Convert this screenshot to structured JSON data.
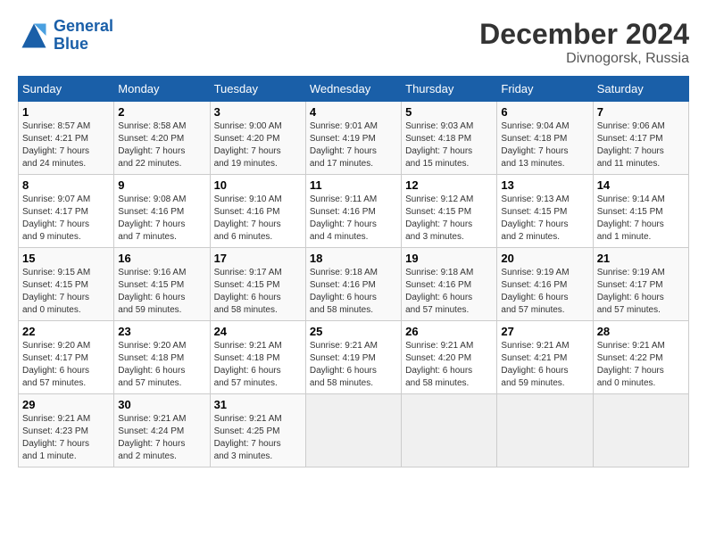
{
  "header": {
    "logo_line1": "General",
    "logo_line2": "Blue",
    "title": "December 2024",
    "subtitle": "Divnogorsk, Russia"
  },
  "weekdays": [
    "Sunday",
    "Monday",
    "Tuesday",
    "Wednesday",
    "Thursday",
    "Friday",
    "Saturday"
  ],
  "weeks": [
    [
      {
        "day": "1",
        "info": "Sunrise: 8:57 AM\nSunset: 4:21 PM\nDaylight: 7 hours\nand 24 minutes."
      },
      {
        "day": "2",
        "info": "Sunrise: 8:58 AM\nSunset: 4:20 PM\nDaylight: 7 hours\nand 22 minutes."
      },
      {
        "day": "3",
        "info": "Sunrise: 9:00 AM\nSunset: 4:20 PM\nDaylight: 7 hours\nand 19 minutes."
      },
      {
        "day": "4",
        "info": "Sunrise: 9:01 AM\nSunset: 4:19 PM\nDaylight: 7 hours\nand 17 minutes."
      },
      {
        "day": "5",
        "info": "Sunrise: 9:03 AM\nSunset: 4:18 PM\nDaylight: 7 hours\nand 15 minutes."
      },
      {
        "day": "6",
        "info": "Sunrise: 9:04 AM\nSunset: 4:18 PM\nDaylight: 7 hours\nand 13 minutes."
      },
      {
        "day": "7",
        "info": "Sunrise: 9:06 AM\nSunset: 4:17 PM\nDaylight: 7 hours\nand 11 minutes."
      }
    ],
    [
      {
        "day": "8",
        "info": "Sunrise: 9:07 AM\nSunset: 4:17 PM\nDaylight: 7 hours\nand 9 minutes."
      },
      {
        "day": "9",
        "info": "Sunrise: 9:08 AM\nSunset: 4:16 PM\nDaylight: 7 hours\nand 7 minutes."
      },
      {
        "day": "10",
        "info": "Sunrise: 9:10 AM\nSunset: 4:16 PM\nDaylight: 7 hours\nand 6 minutes."
      },
      {
        "day": "11",
        "info": "Sunrise: 9:11 AM\nSunset: 4:16 PM\nDaylight: 7 hours\nand 4 minutes."
      },
      {
        "day": "12",
        "info": "Sunrise: 9:12 AM\nSunset: 4:15 PM\nDaylight: 7 hours\nand 3 minutes."
      },
      {
        "day": "13",
        "info": "Sunrise: 9:13 AM\nSunset: 4:15 PM\nDaylight: 7 hours\nand 2 minutes."
      },
      {
        "day": "14",
        "info": "Sunrise: 9:14 AM\nSunset: 4:15 PM\nDaylight: 7 hours\nand 1 minute."
      }
    ],
    [
      {
        "day": "15",
        "info": "Sunrise: 9:15 AM\nSunset: 4:15 PM\nDaylight: 7 hours\nand 0 minutes."
      },
      {
        "day": "16",
        "info": "Sunrise: 9:16 AM\nSunset: 4:15 PM\nDaylight: 6 hours\nand 59 minutes."
      },
      {
        "day": "17",
        "info": "Sunrise: 9:17 AM\nSunset: 4:15 PM\nDaylight: 6 hours\nand 58 minutes."
      },
      {
        "day": "18",
        "info": "Sunrise: 9:18 AM\nSunset: 4:16 PM\nDaylight: 6 hours\nand 58 minutes."
      },
      {
        "day": "19",
        "info": "Sunrise: 9:18 AM\nSunset: 4:16 PM\nDaylight: 6 hours\nand 57 minutes."
      },
      {
        "day": "20",
        "info": "Sunrise: 9:19 AM\nSunset: 4:16 PM\nDaylight: 6 hours\nand 57 minutes."
      },
      {
        "day": "21",
        "info": "Sunrise: 9:19 AM\nSunset: 4:17 PM\nDaylight: 6 hours\nand 57 minutes."
      }
    ],
    [
      {
        "day": "22",
        "info": "Sunrise: 9:20 AM\nSunset: 4:17 PM\nDaylight: 6 hours\nand 57 minutes."
      },
      {
        "day": "23",
        "info": "Sunrise: 9:20 AM\nSunset: 4:18 PM\nDaylight: 6 hours\nand 57 minutes."
      },
      {
        "day": "24",
        "info": "Sunrise: 9:21 AM\nSunset: 4:18 PM\nDaylight: 6 hours\nand 57 minutes."
      },
      {
        "day": "25",
        "info": "Sunrise: 9:21 AM\nSunset: 4:19 PM\nDaylight: 6 hours\nand 58 minutes."
      },
      {
        "day": "26",
        "info": "Sunrise: 9:21 AM\nSunset: 4:20 PM\nDaylight: 6 hours\nand 58 minutes."
      },
      {
        "day": "27",
        "info": "Sunrise: 9:21 AM\nSunset: 4:21 PM\nDaylight: 6 hours\nand 59 minutes."
      },
      {
        "day": "28",
        "info": "Sunrise: 9:21 AM\nSunset: 4:22 PM\nDaylight: 7 hours\nand 0 minutes."
      }
    ],
    [
      {
        "day": "29",
        "info": "Sunrise: 9:21 AM\nSunset: 4:23 PM\nDaylight: 7 hours\nand 1 minute."
      },
      {
        "day": "30",
        "info": "Sunrise: 9:21 AM\nSunset: 4:24 PM\nDaylight: 7 hours\nand 2 minutes."
      },
      {
        "day": "31",
        "info": "Sunrise: 9:21 AM\nSunset: 4:25 PM\nDaylight: 7 hours\nand 3 minutes."
      },
      null,
      null,
      null,
      null
    ]
  ]
}
